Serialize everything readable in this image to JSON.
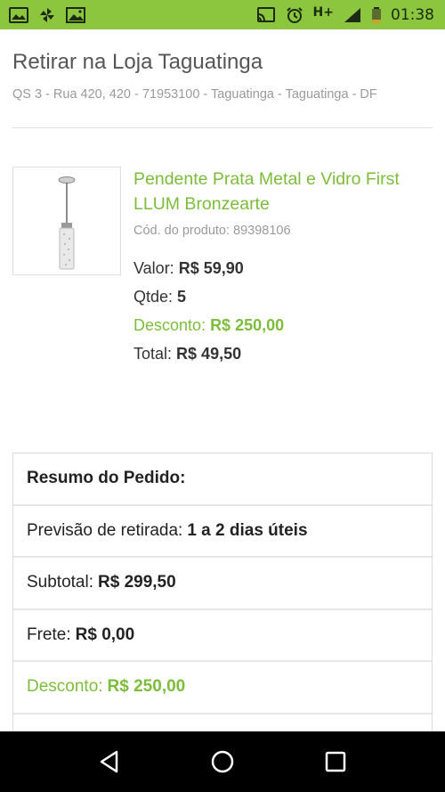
{
  "status_bar": {
    "time": "01:38",
    "network": "H+",
    "left_icons": [
      "photo-icon",
      "pinwheel-icon",
      "image-icon"
    ],
    "right_icons": [
      "cast-icon",
      "alarm-icon",
      "signal-icon",
      "battery-icon"
    ],
    "background": "#8cc63f"
  },
  "store": {
    "title": "Retirar na Loja Taguatinga",
    "address": "QS 3 - Rua 420, 420 - 71953100 - Taguatinga - Taguatinga - DF"
  },
  "product": {
    "name": "Pendente Prata Metal e Vidro First LLUM Bronzearte",
    "code": "Cód. do produto: 89398106",
    "valor_label": "Valor:",
    "valor_value": "R$ 59,90",
    "qtde_label": "Qtde:",
    "qtde_value": "5",
    "desconto_label": "Desconto:",
    "desconto_value": "R$ 250,00",
    "total_label": "Total:",
    "total_value": "R$ 49,50"
  },
  "summary": {
    "title": "Resumo do Pedido:",
    "previsao_label": "Previsão de retirada:",
    "previsao_value": "1 a 2 dias úteis",
    "subtotal_label": "Subtotal:",
    "subtotal_value": "R$ 299,50",
    "frete_label": "Frete:",
    "frete_value": "R$ 0,00",
    "desconto_label": "Desconto:",
    "desconto_value": "R$ 250,00"
  },
  "nav": {
    "buttons": [
      "back-icon",
      "home-icon",
      "recents-icon"
    ]
  },
  "colors": {
    "accent_green": "#7cbd3b",
    "status_green": "#8cc63f",
    "muted_text": "#9a9a9a"
  }
}
